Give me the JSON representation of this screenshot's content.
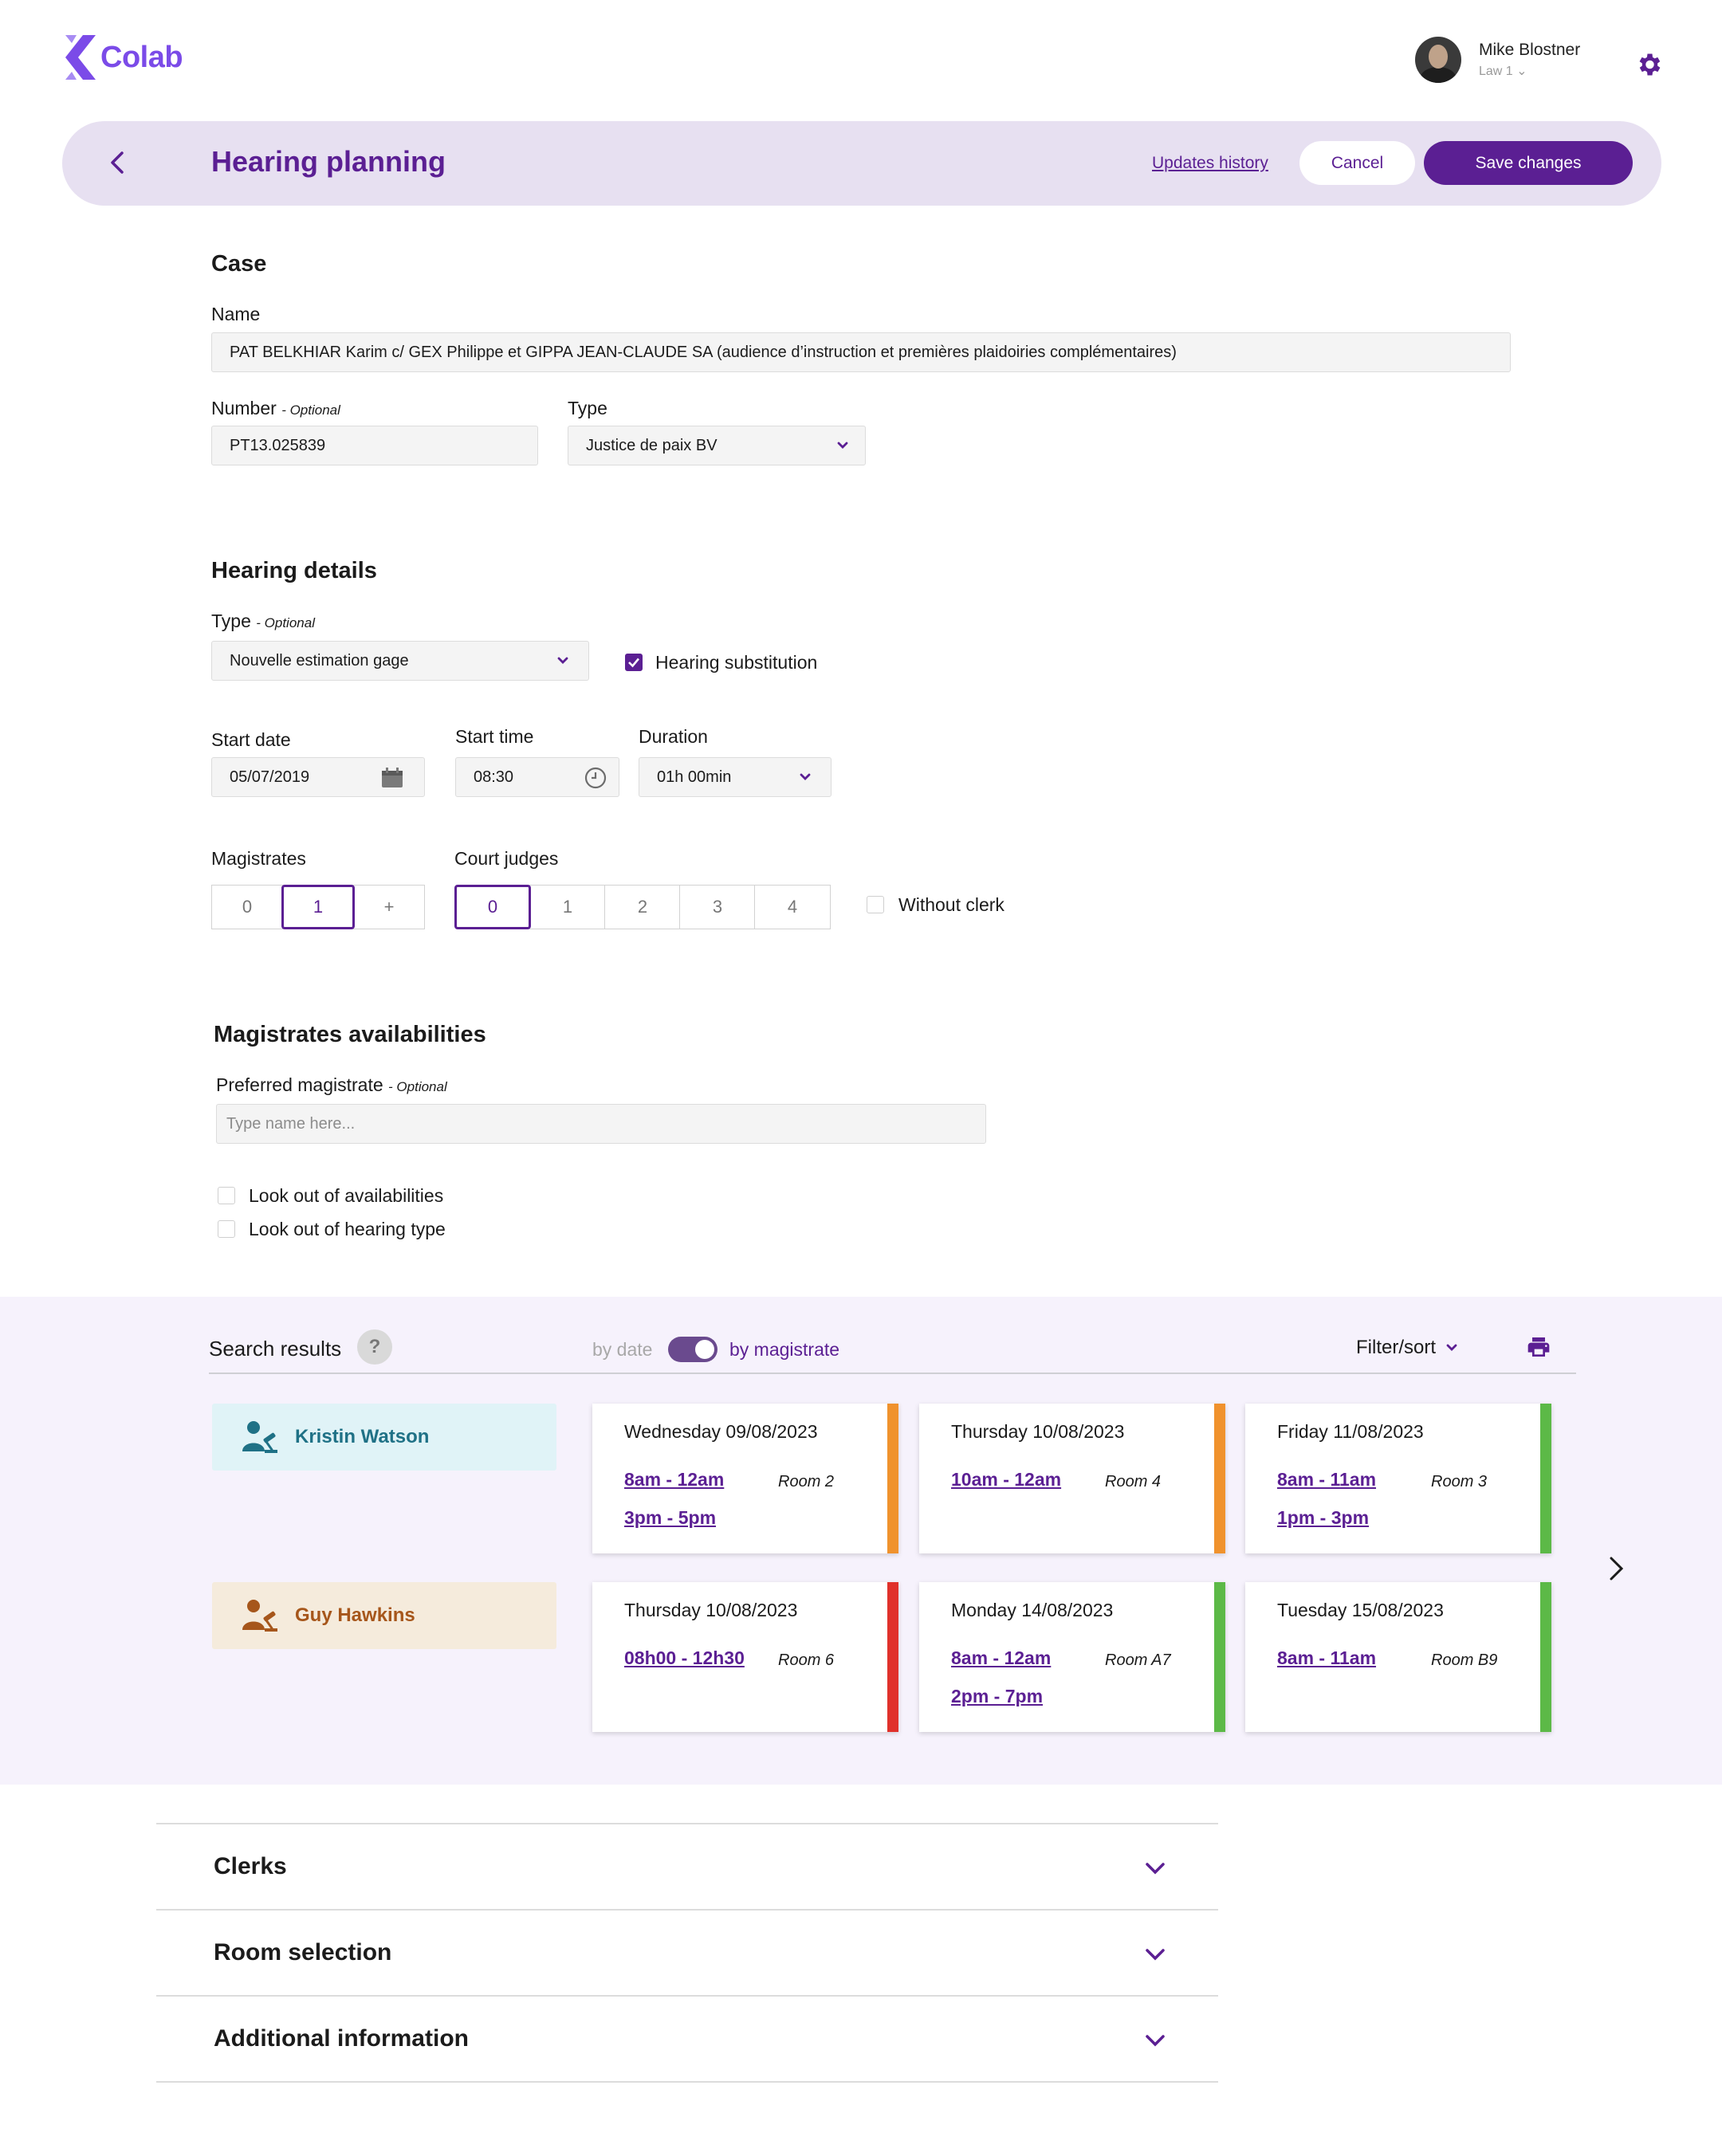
{
  "app": {
    "logo": "Colab"
  },
  "user": {
    "name": "Mike Blostner",
    "sub": "Law 1 ⌄"
  },
  "title_bar": {
    "title": "Hearing planning",
    "updates_link": "Updates history",
    "cancel": "Cancel",
    "save": "Save changes"
  },
  "case": {
    "heading": "Case",
    "name_label": "Name",
    "name_value": "PAT BELKHIAR Karim c/ GEX Philippe et GIPPA JEAN-CLAUDE SA (audience d’instruction et premières plaidoiries complémentaires)",
    "number_label": "Number",
    "optional": "- Optional",
    "number_value": "PT13.025839",
    "type_label": "Type",
    "type_value": "Justice de paix BV"
  },
  "hearing": {
    "heading": "Hearing details",
    "type_label": "Type",
    "optional": "- Optional",
    "type_value": "Nouvelle estimation gage",
    "substitution_label": "Hearing substitution",
    "substitution_checked": true,
    "start_date_label": "Start date",
    "start_date_value": "05/07/2019",
    "start_time_label": "Start time",
    "start_time_value": "08:30",
    "duration_label": "Duration",
    "duration_value": "01h 00min",
    "magistrates_label": "Magistrates",
    "magistrates_options": [
      "0",
      "1",
      "+"
    ],
    "magistrates_selected": "1",
    "judges_label": "Court judges",
    "judges_options": [
      "0",
      "1",
      "2",
      "3",
      "4"
    ],
    "judges_selected": "0",
    "without_clerk_label": "Without clerk"
  },
  "availabilities": {
    "heading": "Magistrates availabilities",
    "preferred_label": "Preferred magistrate",
    "optional": "- Optional",
    "preferred_placeholder": "Type name here...",
    "look_out_availabilities": "Look out of availabilities",
    "look_out_hearing_type": "Look out of hearing type"
  },
  "results": {
    "label": "Search results",
    "help": "?",
    "toggle_left": "by date",
    "toggle_right": "by magistrate",
    "filter": "Filter/sort",
    "magistrates": [
      {
        "name": "Kristin Watson",
        "bg": "#e0f3f7",
        "color": "#1f7186",
        "slots": [
          {
            "date": "Wednesday 09/08/2023",
            "times": [
              "8am - 12am",
              "3pm - 5pm"
            ],
            "room": "Room 2",
            "status": "#f0922d"
          },
          {
            "date": "Thursday 10/08/2023",
            "times": [
              "10am - 12am"
            ],
            "room": "Room 4",
            "status": "#f0922d"
          },
          {
            "date": "Friday 11/08/2023",
            "times": [
              "8am - 11am",
              "1pm - 3pm"
            ],
            "room": "Room 3",
            "status": "#5cb947"
          }
        ]
      },
      {
        "name": "Guy Hawkins",
        "bg": "#f5ebdc",
        "color": "#a6561b",
        "slots": [
          {
            "date": "Thursday 10/08/2023",
            "times": [
              "08h00 - 12h30"
            ],
            "room": "Room 6",
            "status": "#e0312b"
          },
          {
            "date": "Monday 14/08/2023",
            "times": [
              "8am - 12am",
              "2pm - 7pm"
            ],
            "room": "Room A7",
            "status": "#5cb947"
          },
          {
            "date": "Tuesday 15/08/2023",
            "times": [
              "8am - 11am"
            ],
            "room": "Room B9",
            "status": "#5cb947"
          }
        ]
      }
    ]
  },
  "accordions": {
    "clerks": "Clerks",
    "room_selection": "Room selection",
    "additional_information": "Additional information"
  },
  "colors": {
    "accent": "#5b1f93",
    "title_bar_bg": "#e7e0f1",
    "results_bg": "#f6f2fc"
  }
}
